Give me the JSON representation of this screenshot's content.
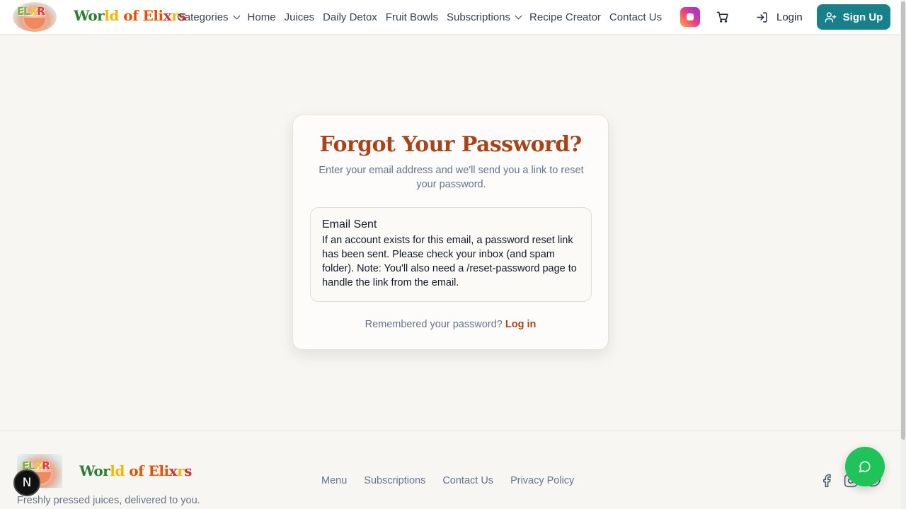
{
  "header": {
    "brand": {
      "part1": "Wor",
      "part2": "ld",
      "part3": " of Eli",
      "part4": "x",
      "part5": "r",
      "part6": "s"
    },
    "nav": [
      {
        "label": "Categories",
        "has_dropdown": true
      },
      {
        "label": "Home"
      },
      {
        "label": "Juices"
      },
      {
        "label": "Daily Detox"
      },
      {
        "label": "Fruit Bowls"
      },
      {
        "label": "Subscriptions",
        "has_dropdown": true
      },
      {
        "label": "Recipe Creator"
      },
      {
        "label": "Contact Us"
      }
    ],
    "login_label": "Login",
    "signup_label": "Sign Up"
  },
  "card": {
    "title": "Forgot Your Password?",
    "subtitle": "Enter your email address and we'll send you a link to reset your password.",
    "alert": {
      "title": "Email Sent",
      "body": "If an account exists for this email, a password reset link has been sent. Please check your inbox (and spam folder). Note: You'll also need a /reset-password page to handle the link from the email."
    },
    "footer_text": "Remembered your password?",
    "footer_link": "Log in"
  },
  "footer": {
    "brand": {
      "part1": "Wor",
      "part2": "ld",
      "part3": " of Eli",
      "part4": "x",
      "part5": "r",
      "part6": "s"
    },
    "tagline": "Freshly pressed juices, delivered to you.",
    "links": [
      "Menu",
      "Subscriptions",
      "Contact Us",
      "Privacy Policy"
    ]
  },
  "logo_letters": {
    "a": "EL",
    "b": "X",
    "c": "R"
  },
  "next_badge": "N",
  "colors": {
    "primary": "#17808b",
    "accent": "#a8431a",
    "chat": "#1fc35a",
    "background": "#f8f6f2"
  },
  "icons": [
    "instagram-icon",
    "cart-icon",
    "login-icon",
    "user-plus-icon",
    "facebook-icon",
    "instagram-icon",
    "twitter-icon",
    "chat-icon"
  ]
}
